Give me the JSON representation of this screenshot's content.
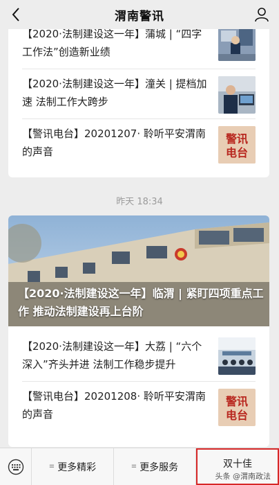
{
  "header": {
    "title": "渭南警讯"
  },
  "card1": {
    "items": [
      {
        "title": "【2020·法制建设这一年】蒲城 | “四字工作法”创造新业绩"
      },
      {
        "title": "【2020·法制建设这一年】潼关 | 提档加速 法制工作大跨步"
      },
      {
        "title": "【警讯电台】20201207· 聆听平安渭南的声音",
        "thumb_text": "警讯\n电台"
      }
    ]
  },
  "timestamp": "昨天 18:34",
  "card2": {
    "hero_title": "【2020·法制建设这一年】临渭 | 紧盯四项重点工作 推动法制建设再上台阶",
    "items": [
      {
        "title": "【2020·法制建设这一年】大荔 | “六个深入”齐头并进 法制工作稳步提升"
      },
      {
        "title": "【警讯电台】20201208· 聆听平安渭南的声音",
        "thumb_text": "警讯\n电台"
      }
    ]
  },
  "bottom_menu": {
    "items": [
      {
        "label": "更多精彩"
      },
      {
        "label": "更多服务"
      },
      {
        "label": "双十佳"
      }
    ],
    "watermark": "头条 @渭南政法"
  },
  "colors": {
    "badge_bg": "#e8cdb4",
    "badge_text": "#b8271f",
    "highlight": "#d72828"
  }
}
